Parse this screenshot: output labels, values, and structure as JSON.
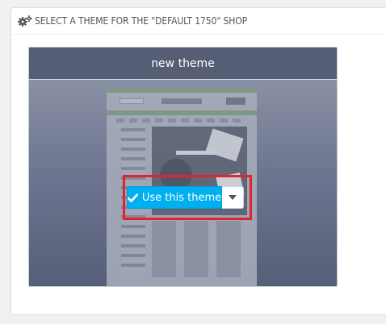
{
  "panel": {
    "heading": "SELECT A THEME FOR THE \"DEFAULT 1750\" SHOP",
    "heading_icon": "gears-icon"
  },
  "theme": {
    "name": "new theme",
    "use_button_label": "Use this theme",
    "use_button_icon": "check-icon",
    "dropdown_icon": "caret-down-icon"
  },
  "colors": {
    "accent": "#00aff0",
    "card_header": "#555e74",
    "highlight": "#e1242b"
  }
}
